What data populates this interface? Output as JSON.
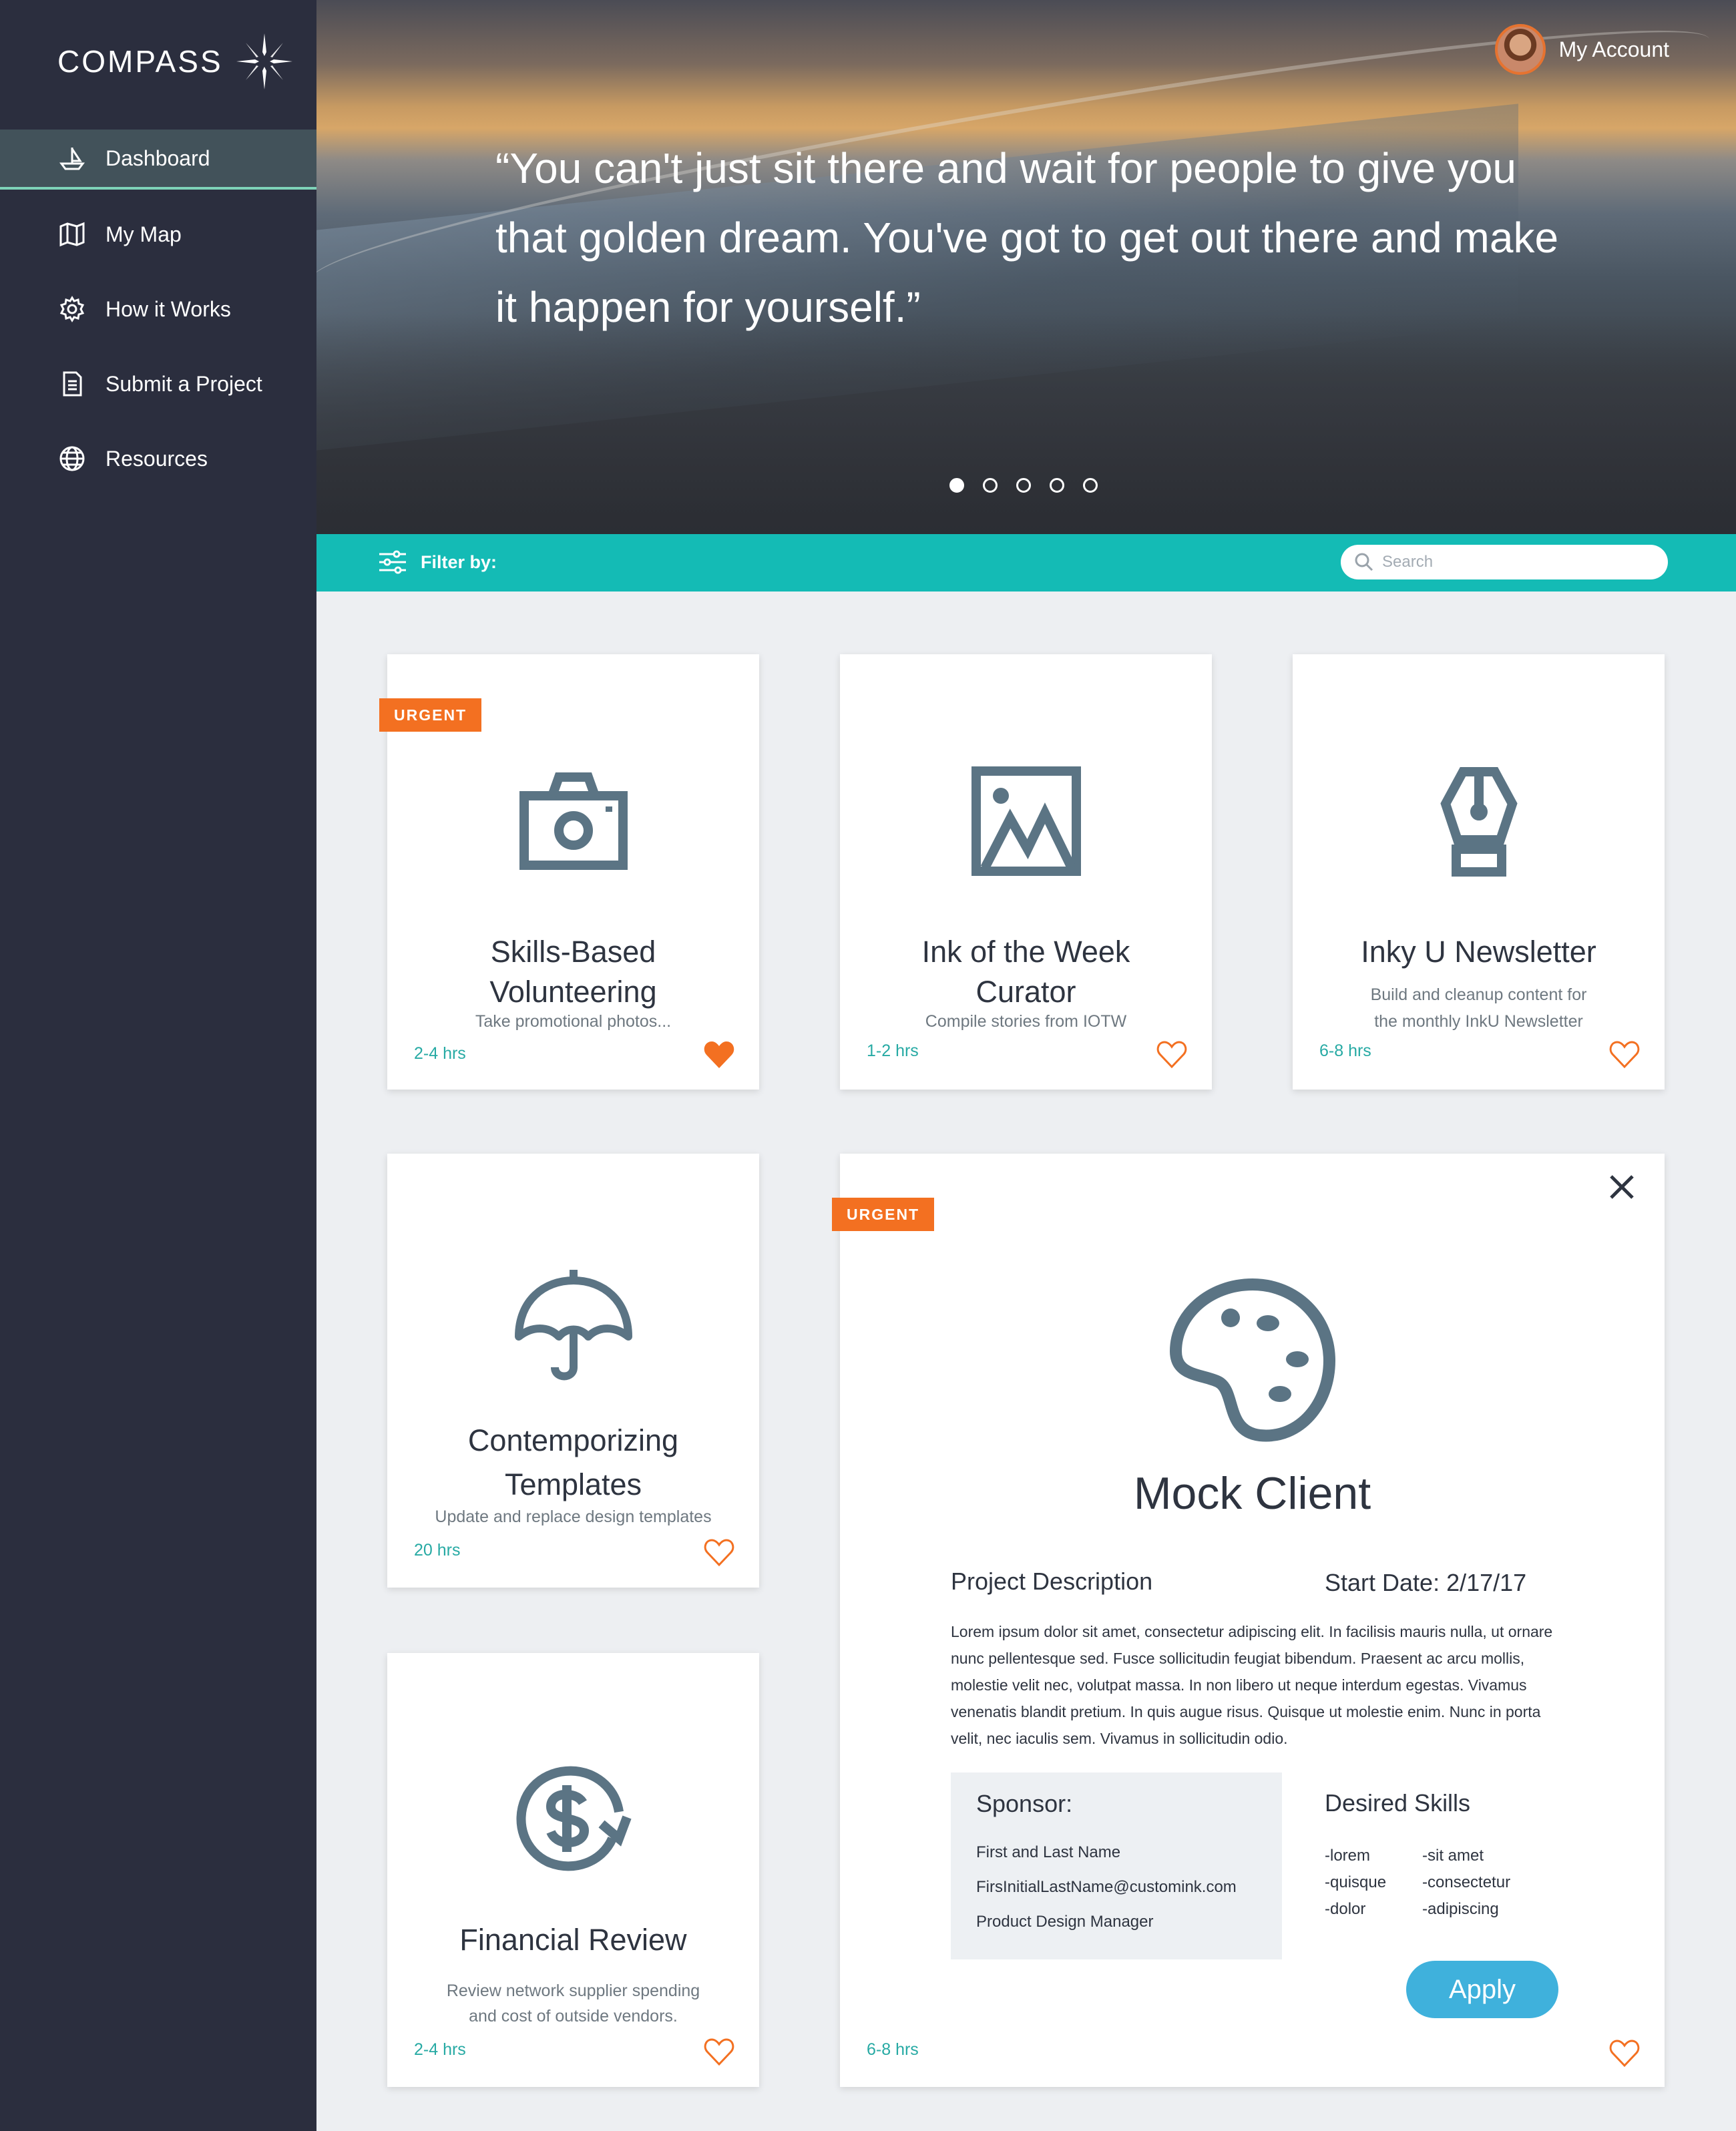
{
  "app": {
    "name": "COMPASS"
  },
  "sidebar": {
    "items": [
      {
        "label": "Dashboard",
        "icon": "boat-icon",
        "active": true
      },
      {
        "label": "My Map",
        "icon": "map-icon"
      },
      {
        "label": "How it Works",
        "icon": "gear-icon"
      },
      {
        "label": "Submit a Project",
        "icon": "document-icon"
      },
      {
        "label": "Resources",
        "icon": "globe-icon"
      }
    ]
  },
  "header": {
    "account_label": "My Account",
    "quote": "“You can't just sit there and wait for people to give you that golden dream. You've got to get out there and make it happen for yourself.”",
    "carousel": {
      "count": 5,
      "active_index": 0
    }
  },
  "filter": {
    "label": "Filter by:",
    "search_placeholder": "Search"
  },
  "cards": [
    {
      "badge": "URGENT",
      "icon": "camera-icon",
      "title_line1": "Skills-Based",
      "title_line2": "Volunteering",
      "subtitle": "Take promotional photos...",
      "hours": "2-4 hrs",
      "favorited": true
    },
    {
      "icon": "image-icon",
      "title_line1": "Ink of the Week",
      "title_line2": "Curator",
      "subtitle": "Compile stories from IOTW",
      "hours": "1-2 hrs",
      "favorited": false
    },
    {
      "icon": "pen-nib-icon",
      "title_line1": "Inky U Newsletter",
      "subtitle_line1": "Build and cleanup content for",
      "subtitle_line2": "the monthly InkU Newsletter",
      "hours": "6-8 hrs",
      "favorited": false
    },
    {
      "icon": "umbrella-icon",
      "title_line1": "Contemporizing",
      "title_line2": "Templates",
      "subtitle": "Update and replace design templates",
      "hours": "20 hrs",
      "favorited": false
    },
    {
      "icon": "dollar-refresh-icon",
      "title_line1": "Financial Review",
      "subtitle_line1": "Review network supplier spending",
      "subtitle_line2": "and cost of outside vendors.",
      "hours": "2-4 hrs",
      "favorited": false
    }
  ],
  "detail": {
    "badge": "URGENT",
    "icon": "palette-icon",
    "title": "Mock Client",
    "description_heading": "Project Description",
    "start_date": "Start Date: 2/17/17",
    "description": "Lorem ipsum dolor sit amet, consectetur adipiscing elit. In facilisis mauris nulla, ut ornare nunc pellentesque sed. Fusce sollicitudin feugiat bibendum. Praesent ac arcu mollis, molestie velit nec, volutpat massa. In non libero ut neque interdum egestas. Vivamus venenatis blandit pretium. In quis augue risus. Quisque ut molestie enim. Nunc in porta velit, nec iaculis sem. Vivamus in sollicitudin odio.",
    "sponsor": {
      "heading": "Sponsor:",
      "name": "First and Last Name",
      "email": "FirsInitialLastName@customink.com",
      "role": "Product Design Manager"
    },
    "skills": {
      "heading": "Desired Skills",
      "col1": [
        "-lorem",
        "-quisque",
        "-dolor"
      ],
      "col2": [
        "-sit amet",
        "-consectetur",
        "-adipiscing"
      ]
    },
    "apply_label": "Apply",
    "hours": "6-8 hrs",
    "favorited": false
  },
  "colors": {
    "sidebar": "#2b2e3e",
    "teal": "#14bbb5",
    "urgent": "#f37021",
    "icon": "#5b7484",
    "apply": "#3fb1dc",
    "heart": "#f37021"
  }
}
